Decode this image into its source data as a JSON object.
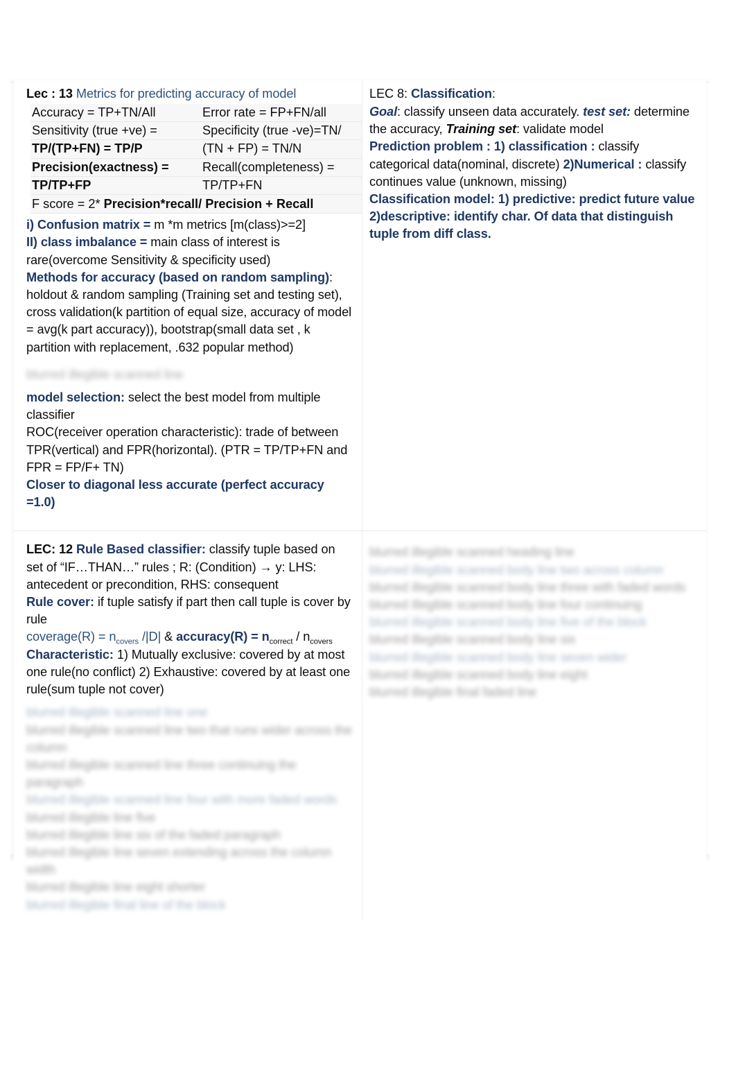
{
  "document": {
    "type": "study-notes",
    "accent_navy": "#1f3864",
    "accent_steel": "#2e5079",
    "body_text": "#0d0d0d",
    "page_background": "#ffffff",
    "table_band_background": "#f7f7f7"
  },
  "cells": {
    "lec13": {
      "heading_label": "Lec : 13",
      "heading_title": "Metrics for predicting accuracy of model",
      "metrics_table": {
        "rows": [
          {
            "left_plain": "Accuracy = TP+TN/All",
            "right_plain": "Error rate = FP+FN/all"
          },
          {
            "left_plain": "Sensitivity (true +ve) =",
            "right_plain": "Specificity (true -ve)=TN/"
          },
          {
            "left_bold": "TP/(TP+FN) = TP/P",
            "right_plain": "(TN + FP) = TN/N"
          },
          {
            "left_bold": "Precision(exactness) =",
            "right_plain": "Recall(completeness) ="
          },
          {
            "left_bold": "TP/TP+FP",
            "right_plain": "TP/TP+FN"
          }
        ],
        "fscore_prefix": "F score = 2* ",
        "fscore_bold": "Precision*recall/ Precision + Recall"
      },
      "confusion_matrix_label": "i) Confusion matrix = ",
      "confusion_matrix_text": "m *m metrics [m(class)>=2]",
      "class_imbalance_label": "II) class imbalance = ",
      "class_imbalance_text": "main class of interest is rare(overcome Sensitivity & specificity used)",
      "methods_label": "Methods for accuracy (based on random sampling)",
      "methods_colon": ":",
      "methods_text": "holdout & random sampling (Training set and testing set), cross validation(k partition of equal size, accuracy of model = avg(k part accuracy)), bootstrap(small data set , k partition with replacement, .632 popular method)",
      "faded_line": "blurred illegible scanned line",
      "model_selection_label": "model selection:",
      "model_selection_text": " select the best model from multiple classifier",
      "roc_text": "ROC(receiver operation characteristic): trade of between TPR(vertical) and FPR(horizontal). (PTR = TP/TP+FN and FPR = FP/F+ TN)",
      "closer_diagonal": "Closer to diagonal less accurate (perfect accuracy =1.0)"
    },
    "lec8": {
      "heading_label": "LEC 8: ",
      "heading_title": "Classification",
      "heading_colon": ":",
      "goal_label": "Goal",
      "goal_text": ":  classify unseen data accurately. ",
      "test_set_label": "test set:",
      "test_set_text": " determine the accuracy, ",
      "training_set_label": "Training set",
      "training_set_text": ": validate model",
      "prediction_problem_label": "Prediction problem :  1) classification :",
      "prediction_problem_text": " classify categorical data(nominal, discrete)  ",
      "numerical_label": "2)Numerical :",
      "numerical_text": " classify continues value (unknown, missing)",
      "classification_model": "Classification model: 1) predictive: predict future value 2)descriptive: identify char. Of data that distinguish tuple from diff class."
    },
    "lec12": {
      "heading_label": "LEC: 12 ",
      "heading_title": "Rule Based classifier:",
      "heading_text": " classify tuple based on set of “IF…THAN…” rules ; R: (Condition) → y: LHS: antecedent or precondition, RHS: consequent",
      "rule_cover_label": "Rule cover:",
      "rule_cover_text": " if tuple satisfy if part then call tuple is cover by rule",
      "coverage_formula": {
        "coverage_label": "coverage(R) = n",
        "coverage_sub": "covers",
        "coverage_tail": " /|D|",
        "amp": "    &  ",
        "accuracy_label": "accuracy(R) = n",
        "accuracy_sub1": "correct",
        "accuracy_mid": " / n",
        "accuracy_sub2": "covers"
      },
      "characteristic_label": "Characteristic:",
      "characteristic_text": "  1) Mutually exclusive: covered by at most one rule(no conflict) 2) Exhaustive: covered by at least one rule(sum tuple not cover)",
      "blurred_block": [
        "blurred illegible scanned line one",
        "blurred illegible scanned line two that runs wider across the column",
        "blurred illegible scanned line three continuing the paragraph",
        "blurred illegible scanned line four with more faded words",
        "blurred illegible line five",
        "blurred illegible line six of the faded paragraph",
        "blurred illegible line seven extending across the column width",
        "blurred illegible line eight shorter",
        "blurred illegible final line of the block"
      ]
    },
    "lec_right_bottom": {
      "blurred_block": [
        "blurred illegible scanned heading line",
        "blurred illegible scanned body line two across column",
        "blurred illegible scanned body line three with faded words",
        "blurred illegible scanned body line four continuing",
        "blurred illegible scanned body line five of the block",
        "blurred illegible scanned body line six",
        "blurred illegible scanned body line seven wider",
        "blurred illegible scanned body line eight",
        "blurred illegible final faded line"
      ]
    }
  }
}
